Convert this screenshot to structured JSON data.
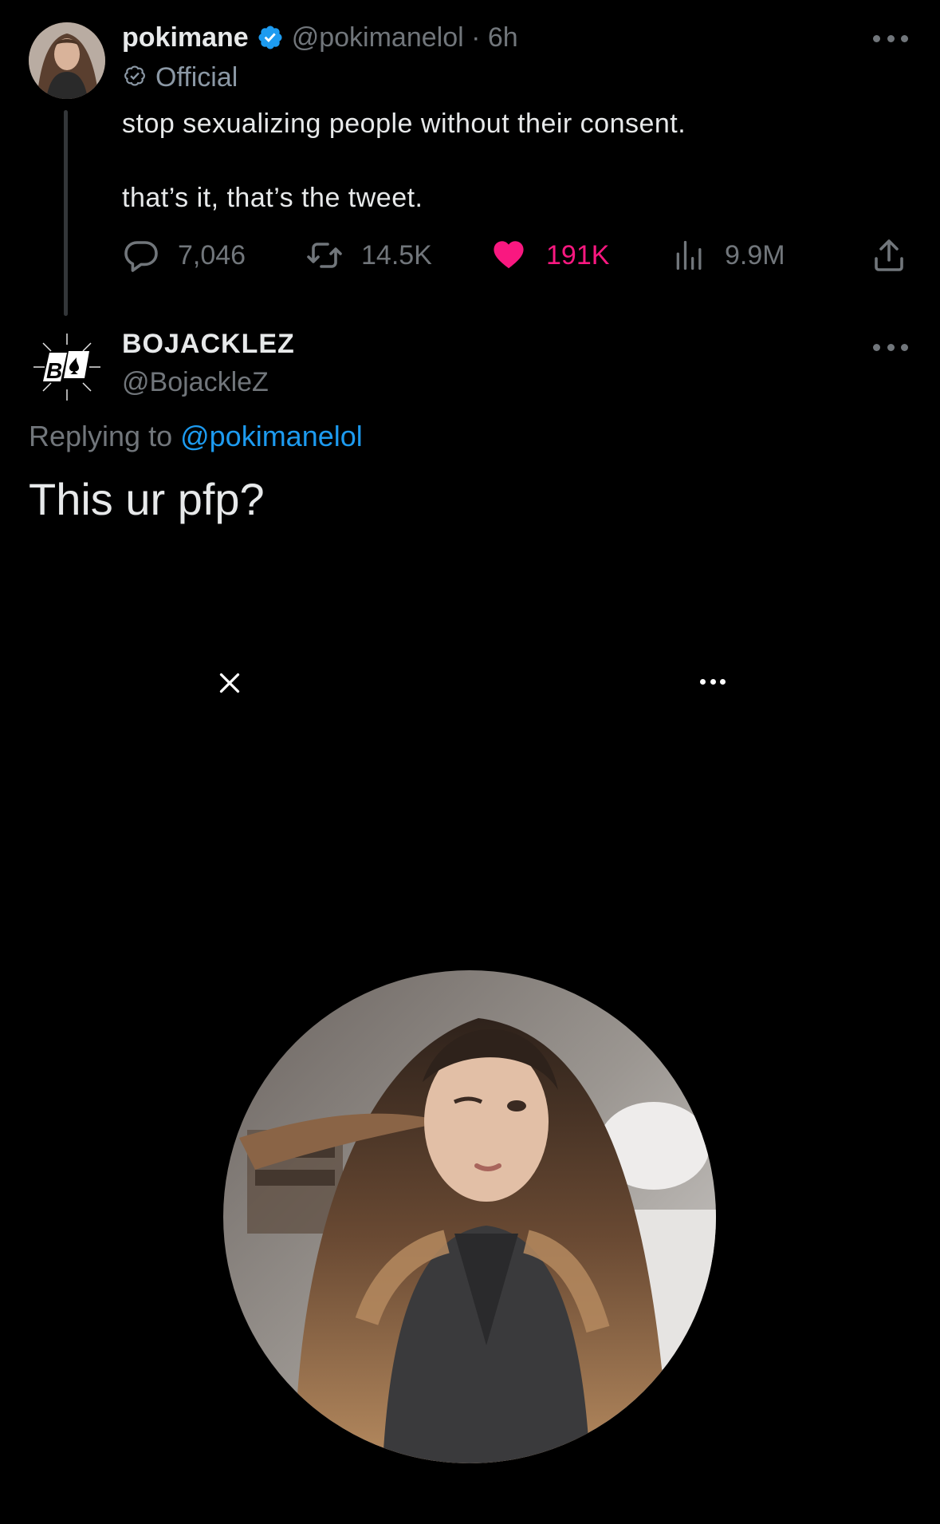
{
  "parent_tweet": {
    "display_name": "pokimane",
    "handle_time": "@pokimanelol · 6h",
    "official_label": "Official",
    "text_line_1": "stop sexualizing people without their consent.",
    "text_line_2": "that’s it, that’s the tweet.",
    "stats": {
      "replies": "7,046",
      "retweets": "14.5K",
      "likes": "191K",
      "views": "9.9M"
    },
    "icons": [
      "avatar",
      "verified-badge-icon",
      "official-check-icon",
      "more-icon",
      "reply-icon",
      "retweet-icon",
      "heart-icon",
      "views-icon",
      "share-icon"
    ]
  },
  "reply_tweet": {
    "display_name": "BOJACKLEZ",
    "handle": "@BojackleZ",
    "replying_to_prefix": "Replying to ",
    "replying_to_mention": "@pokimanelol",
    "text": "This ur pfp?",
    "icons": [
      "avatar",
      "more-icon"
    ]
  },
  "viewer": {
    "icons": [
      "close-icon",
      "more-icon"
    ],
    "image": "profile-picture"
  },
  "colors": {
    "background": "#000000",
    "text": "#e7e9ea",
    "secondary_text": "#71767b",
    "link": "#1d9bf0",
    "like": "#f91880",
    "verified": "#1d9bf0"
  }
}
